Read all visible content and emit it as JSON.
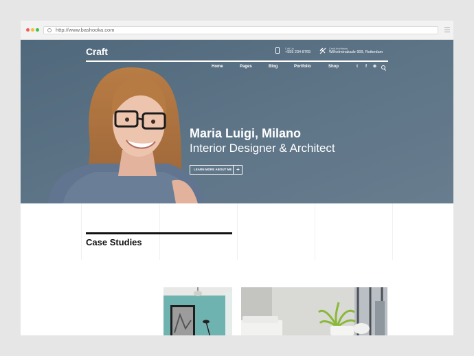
{
  "browser": {
    "url": "http://www.bashooka.com"
  },
  "site": {
    "logo": "Craft",
    "phone_label": "Call Us",
    "phone": "+555 234-8765",
    "address_label": "Craft Architects",
    "address": "Wilhelminakade 909, Rotterdam",
    "nav": [
      "Home",
      "Pages",
      "Blog",
      "Portfolio",
      "Shop"
    ],
    "social": [
      "twitter-icon",
      "facebook-icon",
      "pinterest-icon",
      "search-icon"
    ]
  },
  "hero": {
    "title": "Maria Luigi, Milano",
    "subtitle": "Interior Designer & Architect",
    "cta": "LEARN MORE ABOUT ME",
    "cta_plus": "+"
  },
  "content": {
    "section_title": "Case Studies"
  },
  "colors": {
    "hero_bg": "#5b7285",
    "accent": "#111111"
  }
}
